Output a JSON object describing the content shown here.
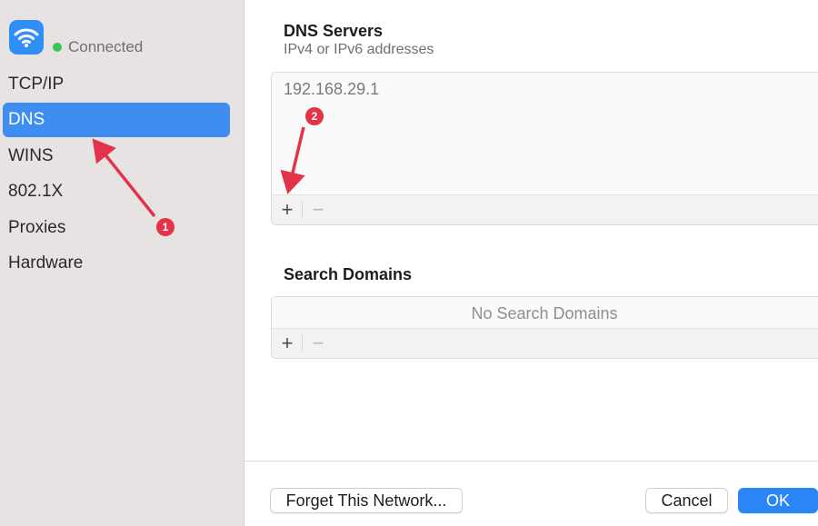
{
  "sidebar": {
    "status": "Connected",
    "items": [
      {
        "label": "TCP/IP",
        "active": false
      },
      {
        "label": "DNS",
        "active": true
      },
      {
        "label": "WINS",
        "active": false
      },
      {
        "label": "802.1X",
        "active": false
      },
      {
        "label": "Proxies",
        "active": false
      },
      {
        "label": "Hardware",
        "active": false
      }
    ]
  },
  "dns": {
    "title": "DNS Servers",
    "subtitle": "IPv4 or IPv6 addresses",
    "entries": [
      "192.168.29.1"
    ],
    "add_label": "+",
    "remove_label": "−"
  },
  "search": {
    "title": "Search Domains",
    "empty_text": "No Search Domains",
    "add_label": "+",
    "remove_label": "−"
  },
  "footer": {
    "forget_label": "Forget This Network...",
    "cancel_label": "Cancel",
    "ok_label": "OK"
  },
  "annotations": [
    {
      "number": "1"
    },
    {
      "number": "2"
    }
  ],
  "colors": {
    "accent": "#3d8ef0",
    "status_green": "#34c759",
    "annotation_red": "#e33348",
    "wifi_tile": "#2f8ff7"
  },
  "icons": {
    "network": "wifi-icon",
    "status": "status-dot-icon"
  }
}
